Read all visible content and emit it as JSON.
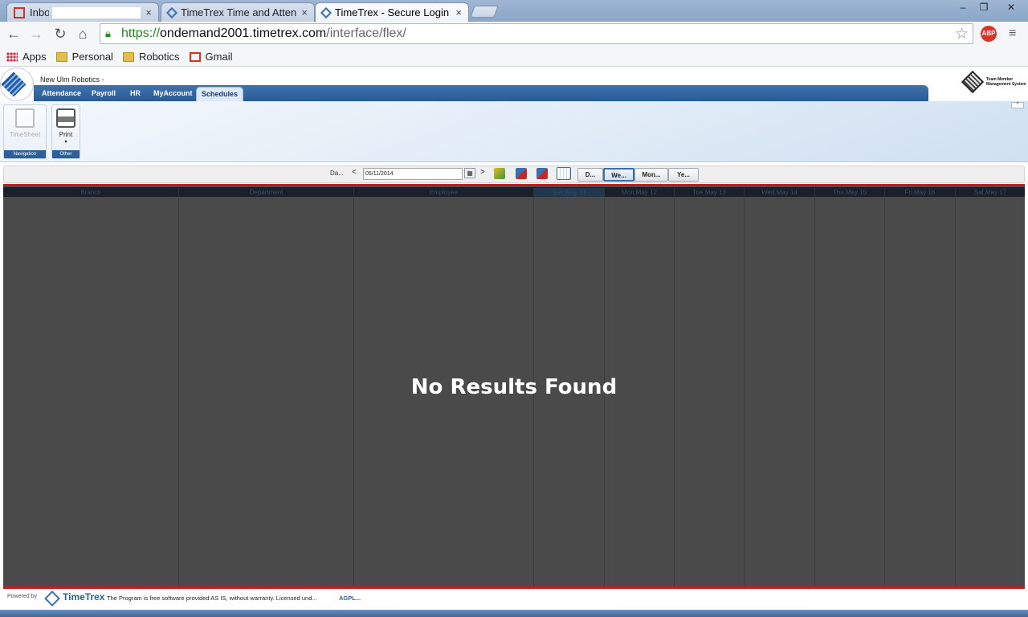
{
  "browser": {
    "tabs": [
      {
        "title": "Inbox -",
        "close": "×"
      },
      {
        "title": "TimeTrex Time and Attendance",
        "close": "×"
      },
      {
        "title": "TimeTrex - Secure Login",
        "close": "×"
      }
    ],
    "window_controls": {
      "minimize": "–",
      "restore": "❐",
      "close": "✕"
    },
    "url": {
      "scheme": "https://",
      "host": "ondemand2001.timetrex.com",
      "path": "/interface/flex/"
    },
    "abp_label": "ABP",
    "bookmarks": [
      {
        "label": "Apps",
        "icon": "apps-icon"
      },
      {
        "label": "Personal",
        "icon": "folder-icon"
      },
      {
        "label": "Robotics",
        "icon": "folder-icon"
      },
      {
        "label": "Gmail",
        "icon": "gmail-icon"
      }
    ]
  },
  "app": {
    "company": "New Ulm Robotics -",
    "menu": [
      "Attendance",
      "Payroll",
      "HR",
      "MyAccount",
      "Schedules"
    ],
    "active_menu": "Schedules",
    "top_right_logo_text": "Team Member Management System",
    "ribbon": {
      "groups": [
        {
          "label": "Navigation",
          "button": "TimeSheet"
        },
        {
          "label": "Other",
          "button": "Print"
        }
      ],
      "collapse": "^"
    },
    "datebar": {
      "label": "Da...",
      "prev": "<",
      "next": ">",
      "date_value": "05/11/2014",
      "picker": "▦",
      "view_buttons": [
        "D...",
        "We...",
        "Mon...",
        "Ye..."
      ],
      "active_view": "We..."
    },
    "grid": {
      "columns": [
        "Branch",
        "Department",
        "Employee",
        "Sun,May 11",
        "Mon,May 12",
        "Tue,May 13",
        "Wed,May 14",
        "Thu,May 15",
        "Fri,May 16",
        "Sat,May 17"
      ],
      "today_column": "Sun,May 11",
      "empty_message": "No Results Found"
    },
    "footer": {
      "powered_by": "Powered by",
      "brand": "TimeTrex",
      "text": "The Program is free software provided AS IS, without warranty. Licensed und...",
      "link": "AGPL..."
    }
  },
  "colors": {
    "accent": "#2d5f9a",
    "grid_bg": "#4a4a4a",
    "red_rule": "#c51d1d"
  }
}
